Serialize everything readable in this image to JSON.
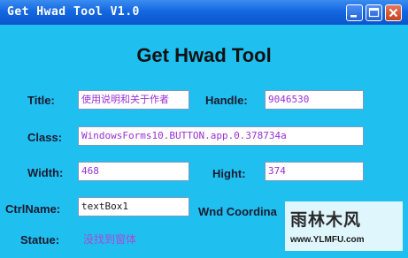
{
  "window": {
    "title": "Get Hwad Tool V1.0",
    "heading": "Get Hwad Tool",
    "colors": {
      "background": "#1fbff0",
      "titlebar": "#1468e0",
      "value_text": "#9a2fd6"
    }
  },
  "titlebar_buttons": {
    "minimize": "minimize-icon",
    "maximize": "maximize-icon",
    "close": "close-icon"
  },
  "fields": {
    "title": {
      "label": "Title:",
      "value": "使用说明和关于作者"
    },
    "handle": {
      "label": "Handle:",
      "value": "9046530"
    },
    "class": {
      "label": "Class:",
      "value": "WindowsForms10.BUTTON.app.0.378734a"
    },
    "width": {
      "label": "Width:",
      "value": "468"
    },
    "hight": {
      "label": "Hight:",
      "value": "374"
    },
    "ctrlname": {
      "label": "CtrlName:",
      "value": "textBox1"
    },
    "wnd_coord": {
      "label": "Wnd Coordina"
    },
    "statue": {
      "label": "Statue:",
      "value": "没找到窗体"
    }
  },
  "watermark": {
    "brand": "雨林木风",
    "url": "www.YLMFU.com"
  }
}
